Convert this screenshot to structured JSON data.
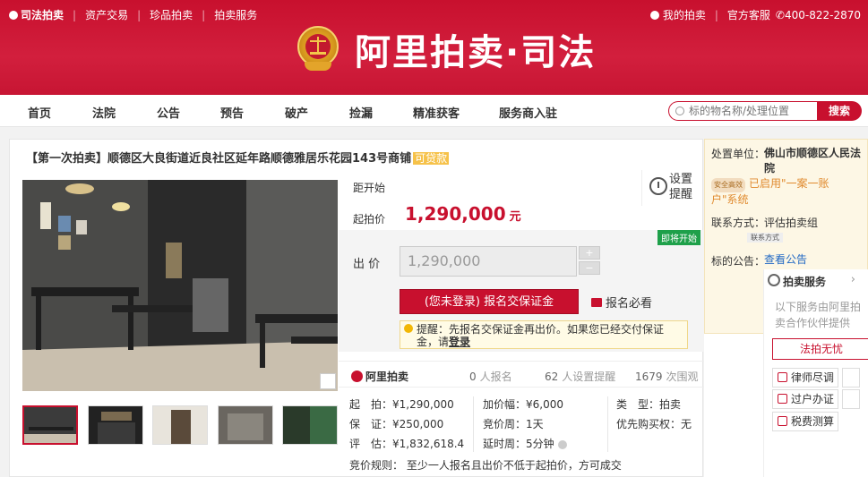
{
  "topnav": {
    "brand": "司法拍卖",
    "links": [
      "资产交易",
      "珍品拍卖",
      "拍卖服务"
    ],
    "my_auction": "我的拍卖",
    "service": "官方客服",
    "phone": "400-822-2870"
  },
  "logo": {
    "text": "阿里拍卖·司法"
  },
  "mainnav": {
    "items": [
      "首页",
      "法院",
      "公告",
      "预告",
      "破产",
      "捡漏",
      "精准获客",
      "服务商入驻"
    ]
  },
  "search": {
    "placeholder": "标的物名称/处理位置",
    "button": "搜索"
  },
  "item": {
    "title": "【第一次拍卖】顺德区大良街道近良社区延年路顺德雅居乐花园143号商铺",
    "title_badge": "可贷款"
  },
  "info": {
    "countdown_label": "距开始",
    "remind": "设置提醒",
    "start_price_label": "起拍价",
    "start_price": "1,290,000",
    "currency": "元",
    "soon_tag": "即将开始",
    "bid_label": "出 价",
    "bid_value": "1,290,000",
    "plus": "+",
    "minus": "−",
    "register_button": "(您未登录) 报名交保证金",
    "must_read": "报名必看",
    "tip_text": "提醒：先报名交保证金再出价。如果您已经交付保证金，请",
    "tip_link": "登录"
  },
  "stats": {
    "brand": "阿里拍卖",
    "signups": "0",
    "signups_label": "人报名",
    "reminders": "62",
    "reminders_label": "人设置提醒",
    "views": "1679",
    "views_label": "次围观"
  },
  "detail": {
    "start_l": "起　拍：",
    "start_v": "¥1,290,000",
    "deposit_l": "保　证：",
    "deposit_v": "¥250,000",
    "assess_l": "评　估：",
    "assess_v": "¥1,832,618.4",
    "incr_l": "加价幅：",
    "incr_v": "¥6,000",
    "cycle_l": "竞价周：",
    "cycle_v": "1天",
    "delay_l": "延时周：",
    "delay_v": "5分钟",
    "type_l": "类　型：",
    "type_v": "拍卖",
    "priority_l": "优先购买权：",
    "priority_v": "无",
    "rule": "竞价规则：  至少一人报名且出价不低于起拍价，方可成交"
  },
  "side": {
    "org_label": "处置单位：",
    "org_value": "佛山市顺德区人民法院",
    "safe_badge": "安全高效",
    "safe_text": "已启用\"一案一账户\"系统",
    "contact_label": "联系方式：",
    "contact_value": "评估拍卖组",
    "contact_chip": "联系方式",
    "notice_label": "标的公告：",
    "notice_link": "查看公告",
    "svc_title": "拍卖服务",
    "svc_arrow": "›",
    "svc_desc": "以下服务由阿里拍卖合作伙伴提供",
    "svc_fp": "法拍无忧",
    "svc_lawyer": "律师尽调",
    "svc_transfer": "过户办证",
    "svc_tax": "税费测算"
  },
  "colors": {
    "brand_red": "#c8102e",
    "link_blue": "#2269c4",
    "green_tag": "#1ea04a"
  }
}
